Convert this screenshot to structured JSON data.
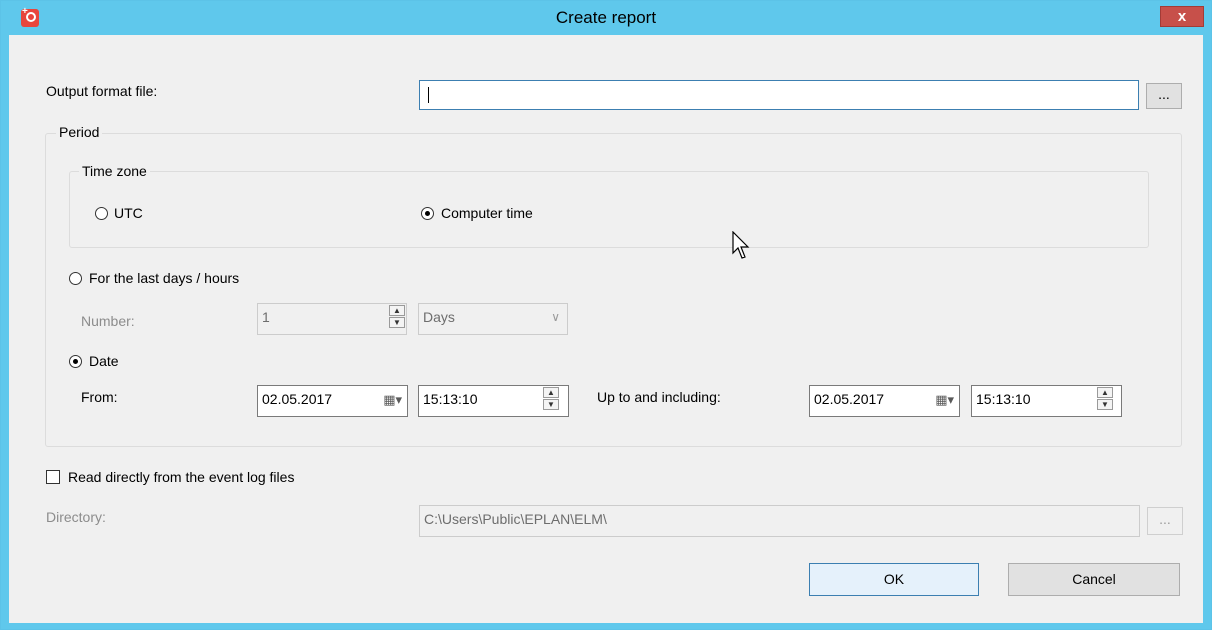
{
  "window": {
    "title": "Create report",
    "close_label": "x",
    "accent": "#5fc8ec"
  },
  "output": {
    "label": "Output format file:",
    "value": "",
    "browse_label": "..."
  },
  "period": {
    "title": "Period",
    "timezone": {
      "title": "Time zone",
      "utc_label": "UTC",
      "computer_label": "Computer time",
      "selected": "Computer time"
    },
    "last_days": {
      "label": "For the last days / hours",
      "number_label": "Number:",
      "number_value": "1",
      "unit_value": "Days"
    },
    "date": {
      "label": "Date",
      "from_label": "From:",
      "from_date": "02.05.2017",
      "from_time": "15:13:10",
      "to_label": "Up to and including:",
      "to_date": "02.05.2017",
      "to_time": "15:13:10"
    }
  },
  "read_direct": {
    "label": "Read directly from the event log files",
    "directory_label": "Directory:",
    "directory_value": "C:\\Users\\Public\\EPLAN\\ELM\\",
    "browse_label": "..."
  },
  "buttons": {
    "ok": "OK",
    "cancel": "Cancel"
  }
}
